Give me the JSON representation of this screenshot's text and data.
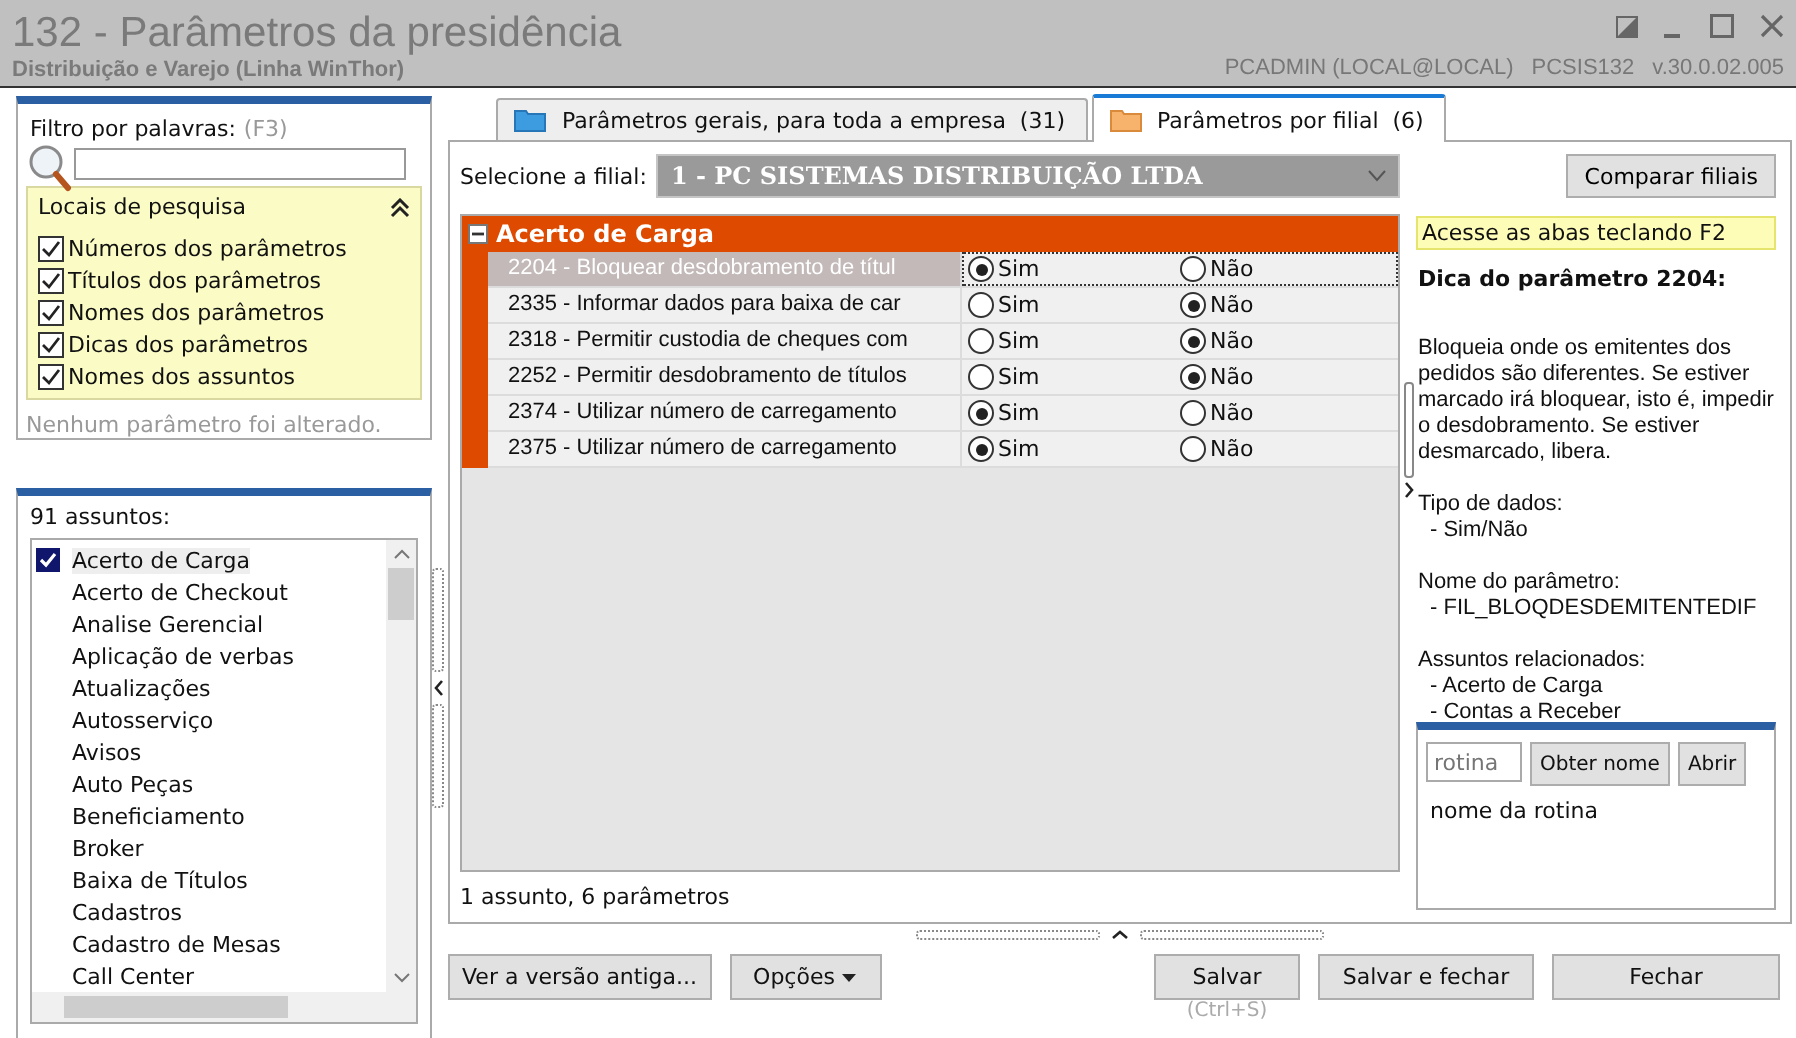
{
  "window": {
    "title": "132 - Parâmetros da presidência",
    "subtitle": "Distribuição e Varejo (Linha WinThor)",
    "user": "PCADMIN (LOCAL@LOCAL)",
    "program": "PCSIS132",
    "version": "v.30.0.02.005"
  },
  "filter": {
    "label": "Filtro por palavras:",
    "shortcut": "(F3)"
  },
  "search_locations": {
    "title": "Locais de pesquisa",
    "expanded": true,
    "options": [
      {
        "label": "Números dos parâmetros",
        "checked": true
      },
      {
        "label": "Títulos dos parâmetros",
        "checked": true
      },
      {
        "label": "Nomes dos parâmetros",
        "checked": true
      },
      {
        "label": "Dicas dos parâmetros",
        "checked": true
      },
      {
        "label": "Nomes dos assuntos",
        "checked": true
      }
    ]
  },
  "change_status": "Nenhum parâmetro foi alterado.",
  "subjects": {
    "count_label": "91 assuntos:",
    "items": [
      {
        "label": "Acerto de Carga",
        "selected": true
      },
      {
        "label": "Acerto de Checkout",
        "selected": false
      },
      {
        "label": "Analise Gerencial",
        "selected": false
      },
      {
        "label": "Aplicação de verbas",
        "selected": false
      },
      {
        "label": "Atualizações",
        "selected": false
      },
      {
        "label": "Autosserviço",
        "selected": false
      },
      {
        "label": "Avisos",
        "selected": false
      },
      {
        "label": "Auto Peças",
        "selected": false
      },
      {
        "label": "Beneficiamento",
        "selected": false
      },
      {
        "label": "Broker",
        "selected": false
      },
      {
        "label": "Baixa de Títulos",
        "selected": false
      },
      {
        "label": "Cadastros",
        "selected": false
      },
      {
        "label": "Cadastro de Mesas",
        "selected": false
      },
      {
        "label": "Call Center",
        "selected": false
      }
    ]
  },
  "tabs": [
    {
      "label": "Parâmetros gerais, para toda a empresa",
      "count": "(31)",
      "selected": false
    },
    {
      "label": "Parâmetros por filial",
      "count": "(6)",
      "selected": true
    }
  ],
  "branch": {
    "label": "Selecione a filial:",
    "value": "1 - PC SISTEMAS DISTRIBUIÇÃO LTDA",
    "compare_button": "Comparar filiais"
  },
  "group": {
    "title": "Acerto de Carga",
    "expanded": true,
    "rows": [
      {
        "label": "2204 - Bloquear desdobramento de títul",
        "selected": true,
        "options": [
          {
            "label": "Sim",
            "selected": true
          },
          {
            "label": "Não",
            "selected": false
          }
        ]
      },
      {
        "label": "2335 - Informar dados para baixa de car",
        "selected": false,
        "options": [
          {
            "label": "Sim",
            "selected": false
          },
          {
            "label": "Não",
            "selected": true
          }
        ]
      },
      {
        "label": "2318 - Permitir custodia de cheques com",
        "selected": false,
        "options": [
          {
            "label": "Sim",
            "selected": false
          },
          {
            "label": "Não",
            "selected": true
          }
        ]
      },
      {
        "label": "2252 - Permitir desdobramento de títulos",
        "selected": false,
        "options": [
          {
            "label": "Sim",
            "selected": false
          },
          {
            "label": "Não",
            "selected": true
          }
        ]
      },
      {
        "label": "2374 - Utilizar número de carregamento",
        "selected": false,
        "options": [
          {
            "label": "Sim",
            "selected": true
          },
          {
            "label": "Não",
            "selected": false
          }
        ]
      },
      {
        "label": "2375 - Utilizar número de carregamento",
        "selected": false,
        "options": [
          {
            "label": "Sim",
            "selected": true
          },
          {
            "label": "Não",
            "selected": false
          }
        ]
      }
    ]
  },
  "grid_status": "1 assunto, 6 parâmetros",
  "hint": {
    "banner": "Acesse as abas teclando F2",
    "title": "Dica do parâmetro 2204:",
    "description": "Bloqueia onde os emitentes dos pedidos são diferentes. Se estiver marcado irá bloquear, isto é, impedir o desdobramento. Se estiver desmarcado, libera.",
    "sections": [
      {
        "heading": "Tipo de dados:",
        "items": [
          "- Sim/Não"
        ]
      },
      {
        "heading": "Nome do parâmetro:",
        "items": [
          "- FIL_BLOQDESDEMITENTEDIF"
        ]
      },
      {
        "heading": "Assuntos relacionados:",
        "items": [
          "- Acerto de Carga",
          "- Contas a Receber"
        ]
      }
    ]
  },
  "routine": {
    "placeholder": "rotina",
    "get_name_button": "Obter nome",
    "open_button": "Abrir",
    "name": "nome da rotina"
  },
  "footer": {
    "old_version_button": "Ver a versão antiga...",
    "options_button": "Opções",
    "save_button": "Salvar",
    "save_shortcut": "(Ctrl+S)",
    "save_close_button": "Salvar e fechar",
    "close_button": "Fechar"
  }
}
